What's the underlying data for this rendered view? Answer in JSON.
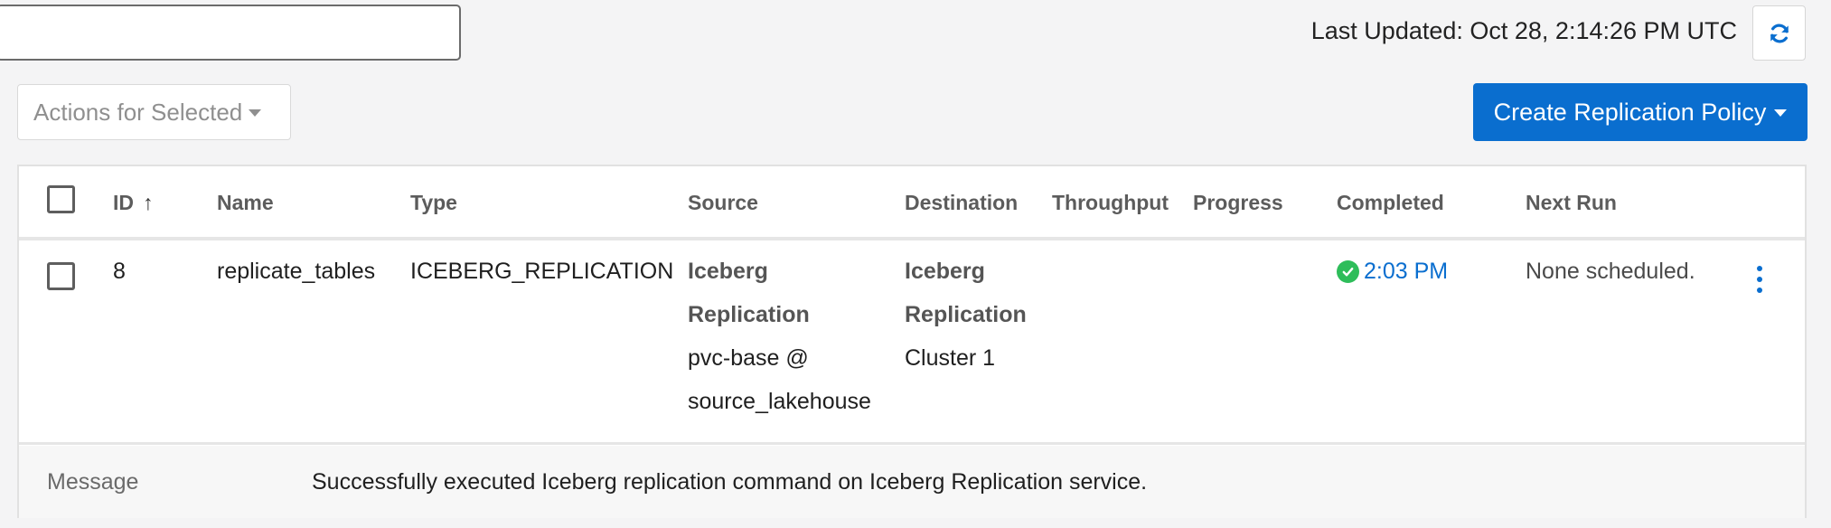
{
  "search": {
    "value": ""
  },
  "header": {
    "last_updated": "Last Updated: Oct 28, 2:14:26 PM UTC",
    "refresh_icon": "refresh-icon"
  },
  "toolbar": {
    "actions_label": "Actions for Selected",
    "create_label": "Create Replication Policy"
  },
  "colors": {
    "primary": "#0a6ecf",
    "success": "#2ebd5a"
  },
  "table": {
    "columns": {
      "id": "ID",
      "id_sort": "↑",
      "name": "Name",
      "type": "Type",
      "source": "Source",
      "destination": "Destination",
      "throughput": "Throughput",
      "progress": "Progress",
      "completed": "Completed",
      "next_run": "Next Run"
    },
    "rows": [
      {
        "id": "8",
        "name": "replicate_tables",
        "type": "ICEBERG_REPLICATION",
        "source_title_1": "Iceberg",
        "source_title_2": "Replication",
        "source_detail_1": "pvc-base @",
        "source_detail_2": "source_lakehouse",
        "destination_title_1": "Iceberg",
        "destination_title_2": "Replication",
        "destination_detail": "Cluster 1",
        "throughput": "",
        "progress": "",
        "completed": "2:03 PM",
        "completed_status": "success",
        "next_run": "None scheduled."
      }
    ],
    "message": {
      "label": "Message",
      "text": "Successfully executed Iceberg replication command on Iceberg Replication service."
    }
  }
}
